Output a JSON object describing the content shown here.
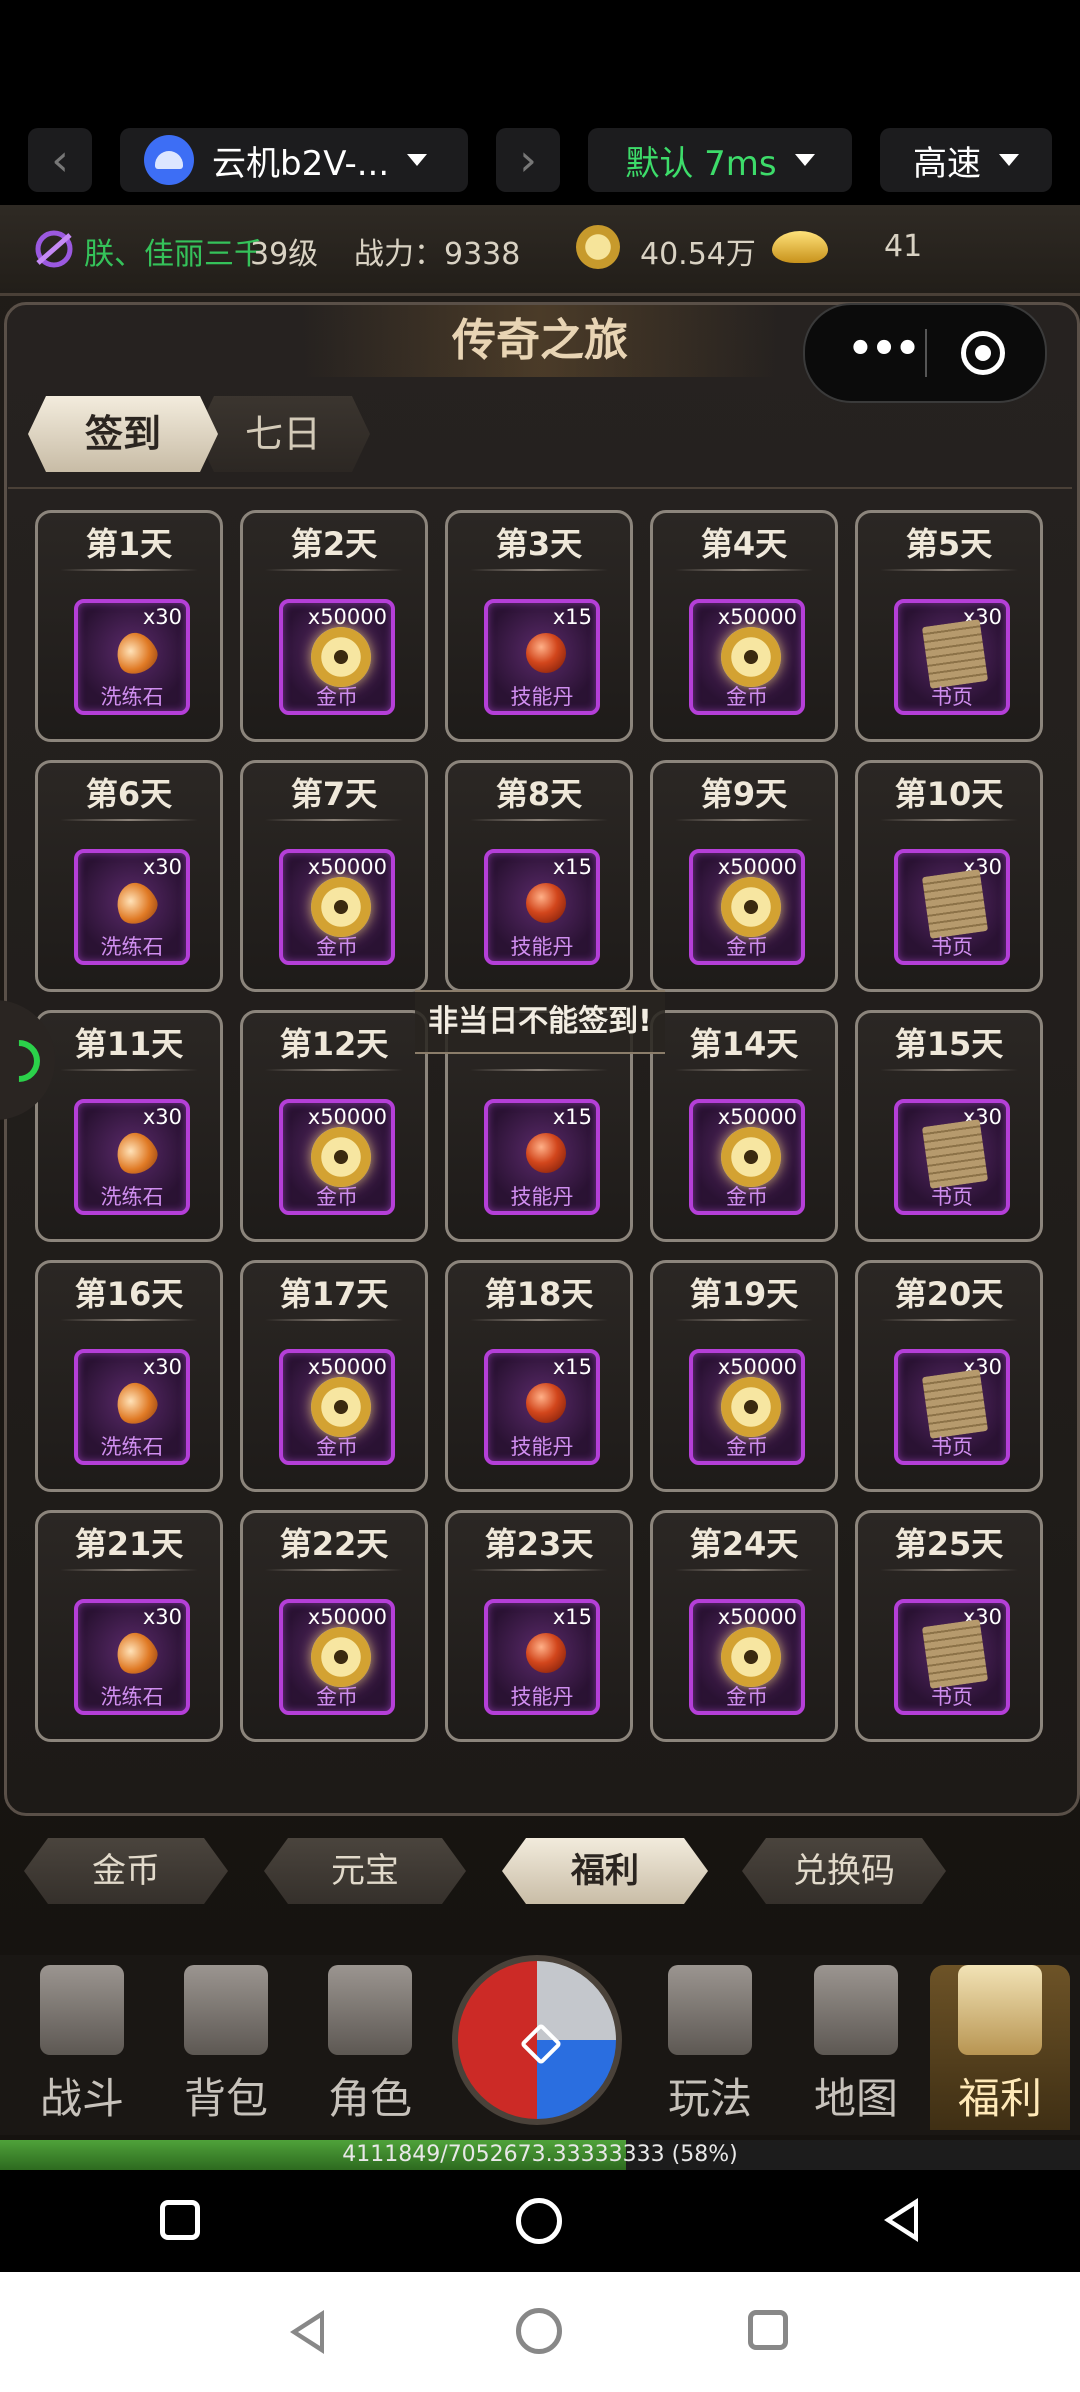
{
  "topbar": {
    "device_label": "云机b2V-...",
    "quality_label": "默认 7ms",
    "speed_label": "高速",
    "icons": [
      "back-arrow-icon",
      "android-icon",
      "forward-arrow-icon"
    ]
  },
  "status": {
    "name": "朕、佳丽三千",
    "level": "39级",
    "power": "战力：9338",
    "gold": "40.54万",
    "ingot": "41"
  },
  "panel": {
    "title": "传奇之旅",
    "tabs": [
      "签到",
      "七日"
    ],
    "active_tab": "签到",
    "toast": "非当日不能签到!"
  },
  "days": [
    {
      "day": "第1天",
      "qty": "x30",
      "item": "洗练石",
      "icon": "stone"
    },
    {
      "day": "第2天",
      "qty": "x50000",
      "item": "金币",
      "icon": "coin"
    },
    {
      "day": "第3天",
      "qty": "x15",
      "item": "技能丹",
      "icon": "pill"
    },
    {
      "day": "第4天",
      "qty": "x50000",
      "item": "金币",
      "icon": "coin"
    },
    {
      "day": "第5天",
      "qty": "x30",
      "item": "书页",
      "icon": "page"
    },
    {
      "day": "第6天",
      "qty": "x30",
      "item": "洗练石",
      "icon": "stone"
    },
    {
      "day": "第7天",
      "qty": "x50000",
      "item": "金币",
      "icon": "coin"
    },
    {
      "day": "第8天",
      "qty": "x15",
      "item": "技能丹",
      "icon": "pill"
    },
    {
      "day": "第9天",
      "qty": "x50000",
      "item": "金币",
      "icon": "coin"
    },
    {
      "day": "第10天",
      "qty": "x30",
      "item": "书页",
      "icon": "page"
    },
    {
      "day": "第11天",
      "qty": "x30",
      "item": "洗练石",
      "icon": "stone"
    },
    {
      "day": "第12天",
      "qty": "x50000",
      "item": "金币",
      "icon": "coin"
    },
    {
      "day": "",
      "qty": "x15",
      "item": "技能丹",
      "icon": "pill"
    },
    {
      "day": "第14天",
      "qty": "x50000",
      "item": "金币",
      "icon": "coin"
    },
    {
      "day": "第15天",
      "qty": "x30",
      "item": "书页",
      "icon": "page"
    },
    {
      "day": "第16天",
      "qty": "x30",
      "item": "洗练石",
      "icon": "stone"
    },
    {
      "day": "第17天",
      "qty": "x50000",
      "item": "金币",
      "icon": "coin"
    },
    {
      "day": "第18天",
      "qty": "x15",
      "item": "技能丹",
      "icon": "pill"
    },
    {
      "day": "第19天",
      "qty": "x50000",
      "item": "金币",
      "icon": "coin"
    },
    {
      "day": "第20天",
      "qty": "x30",
      "item": "书页",
      "icon": "page"
    },
    {
      "day": "第21天",
      "qty": "x30",
      "item": "洗练石",
      "icon": "stone"
    },
    {
      "day": "第22天",
      "qty": "x50000",
      "item": "金币",
      "icon": "coin"
    },
    {
      "day": "第23天",
      "qty": "x15",
      "item": "技能丹",
      "icon": "pill"
    },
    {
      "day": "第24天",
      "qty": "x50000",
      "item": "金币",
      "icon": "coin"
    },
    {
      "day": "第25天",
      "qty": "x30",
      "item": "书页",
      "icon": "page"
    }
  ],
  "filters": [
    {
      "label": "金币",
      "active": false
    },
    {
      "label": "元宝",
      "active": false
    },
    {
      "label": "福利",
      "active": true
    },
    {
      "label": "兑换码",
      "active": false
    }
  ],
  "nav": [
    "战斗",
    "背包",
    "角色",
    "玩法",
    "地图",
    "福利"
  ],
  "nav_active": "福利",
  "exp": {
    "text": "4111849/7052673.33333333 (58%)",
    "fraction": 0.58
  },
  "colors": {
    "name_green": "#35c25a",
    "item_frame_purple": "#b53fd8",
    "quality_green": "#3ddc6a"
  }
}
